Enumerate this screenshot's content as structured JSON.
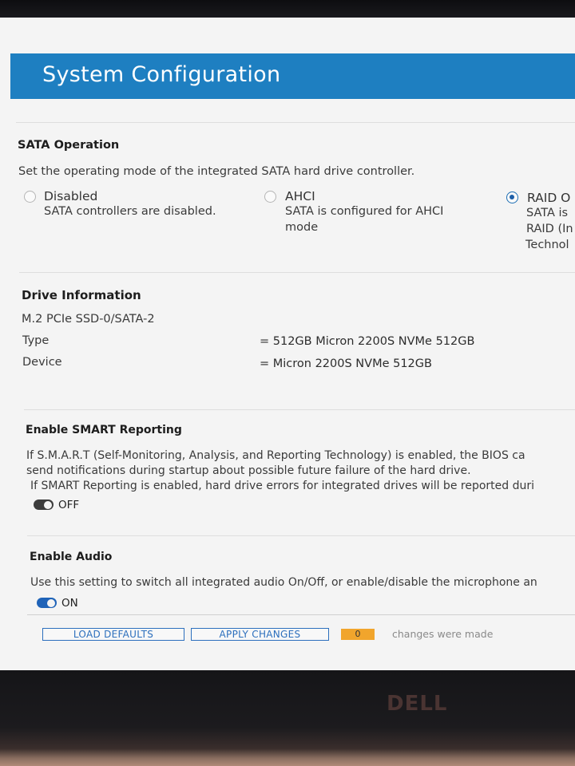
{
  "page_title": "System Configuration",
  "sata_operation": {
    "title": "SATA Operation",
    "description": "Set the operating mode of the integrated SATA hard drive controller.",
    "options": [
      {
        "label": "Disabled",
        "detail_lines": [
          "SATA controllers are disabled."
        ],
        "selected": false
      },
      {
        "label": "AHCI",
        "detail_lines": [
          "SATA is configured for AHCI",
          "mode"
        ],
        "selected": false
      },
      {
        "label": "RAID O",
        "detail_lines": [
          "SATA is",
          "RAID (In",
          "Technol"
        ],
        "selected": true
      }
    ]
  },
  "drive_information": {
    "title": "Drive Information",
    "drive_name": "M.2 PCIe SSD-0/SATA-2",
    "rows": [
      {
        "label": "Type",
        "value": "= 512GB Micron 2200S NVMe 512GB"
      },
      {
        "label": "Device",
        "value": "= Micron 2200S NVMe 512GB"
      }
    ]
  },
  "smart_reporting": {
    "title": "Enable SMART Reporting",
    "description_lines": [
      "If S.M.A.R.T (Self-Monitoring, Analysis, and Reporting Technology) is enabled, the BIOS ca",
      "send notifications during startup about possible future failure of the hard drive.",
      "If SMART Reporting is enabled, hard drive errors for integrated drives will be reported duri"
    ],
    "toggle_label": "OFF",
    "enabled": false
  },
  "audio": {
    "title": "Enable Audio",
    "description": "Use this setting to switch all integrated audio On/Off, or enable/disable the microphone an",
    "toggle_label": "ON",
    "enabled": true
  },
  "footer": {
    "load_defaults_label": "LOAD DEFAULTS",
    "apply_changes_label": "APPLY CHANGES",
    "changes_count": "0",
    "changes_text": "changes were made"
  },
  "bezel": {
    "brand": "DELL"
  },
  "colors": {
    "title_bar": "#1e7fc1",
    "toggle_on": "#1f63b8",
    "changes_badge": "#f1a52c"
  }
}
